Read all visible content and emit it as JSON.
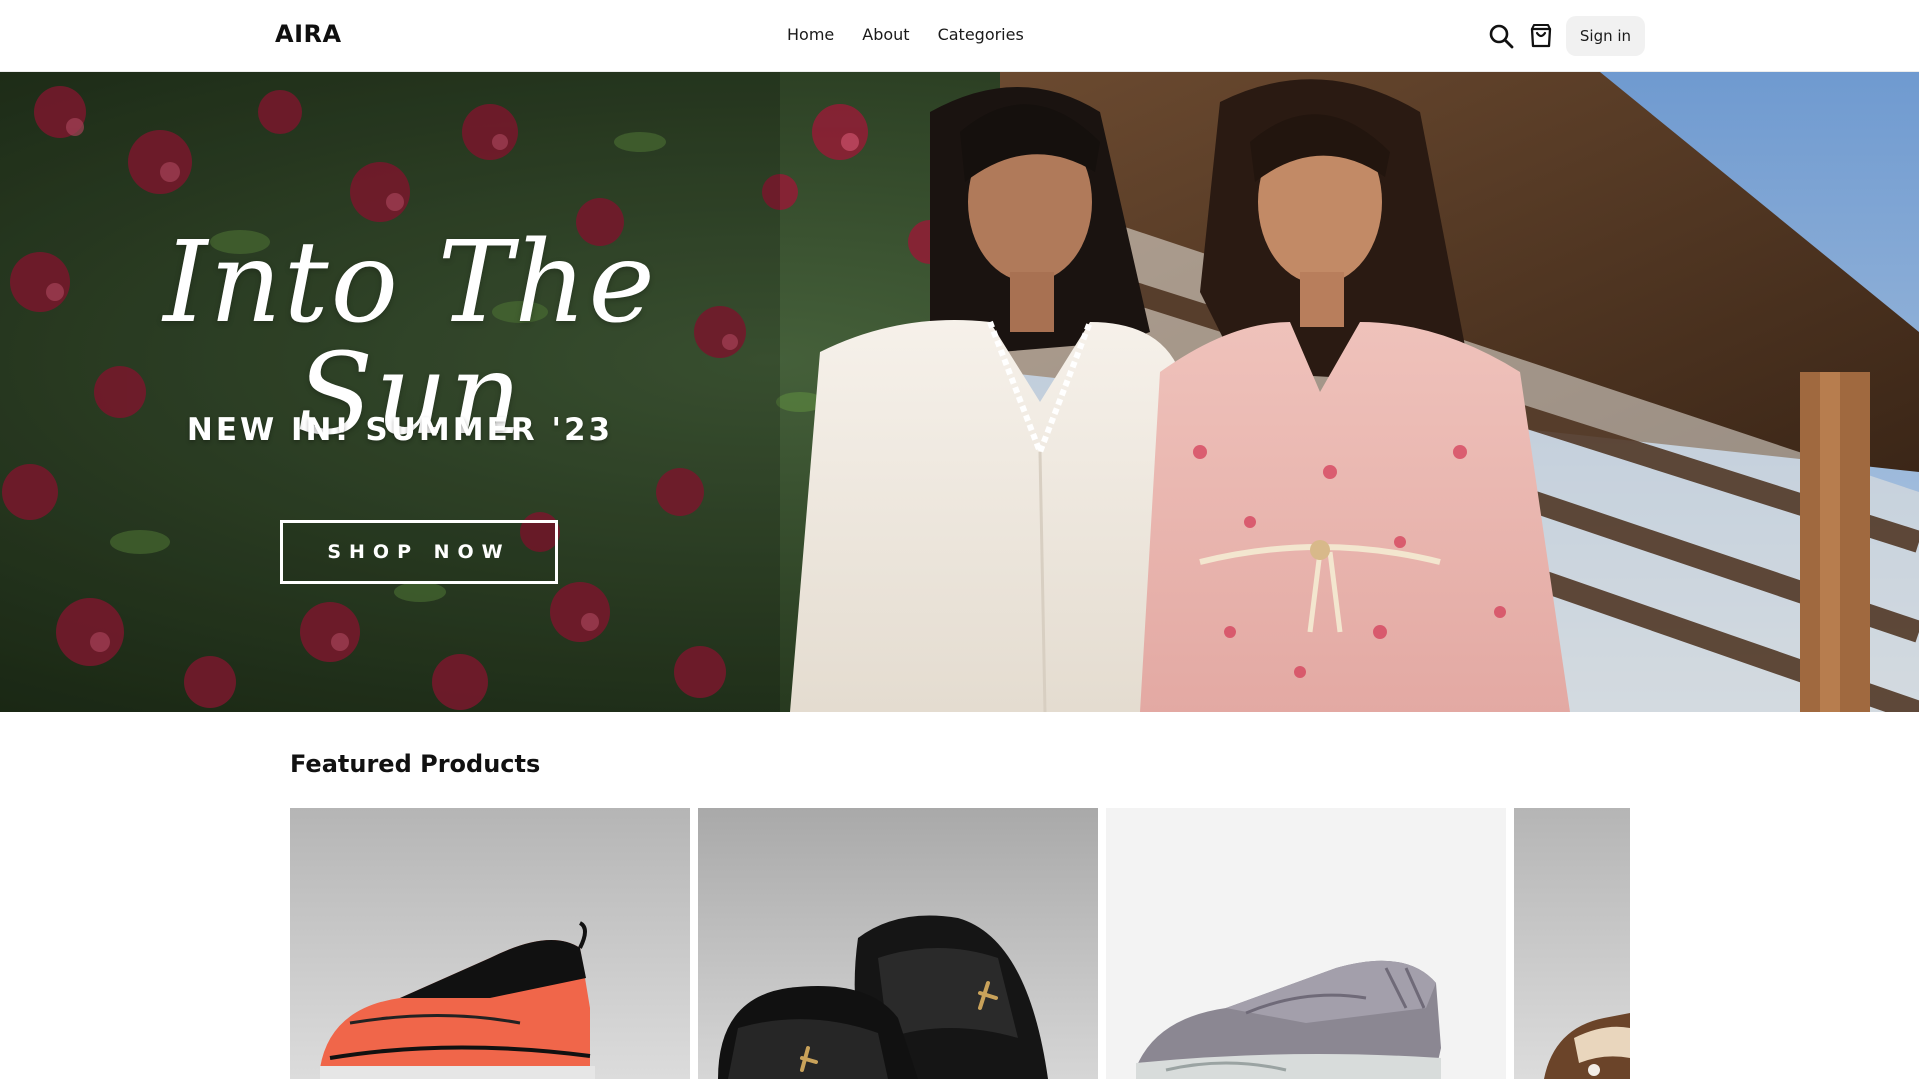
{
  "header": {
    "logo": "AIRA",
    "nav": [
      "Home",
      "About",
      "Categories"
    ],
    "signin_label": "Sign in",
    "icons": [
      "search-icon",
      "cart-icon"
    ]
  },
  "hero": {
    "script_title": "Into The Sun",
    "subtitle": "NEW IN! SUMMER '23",
    "cta_label": "SHOP NOW",
    "colors": {
      "foliage": "#2f4a26",
      "flowers": "#8e1f35",
      "sky": "#7fa8d6",
      "roof": "#5a3a22"
    }
  },
  "featured": {
    "title": "Featured Products",
    "products": [
      {
        "image": "orange-sneaker",
        "color": "#f0664a"
      },
      {
        "image": "black-slides",
        "color": "#111111"
      },
      {
        "image": "grey-sneaker",
        "color": "#8b8792"
      },
      {
        "image": "brown-shoe",
        "color": "#6b4429"
      }
    ]
  }
}
